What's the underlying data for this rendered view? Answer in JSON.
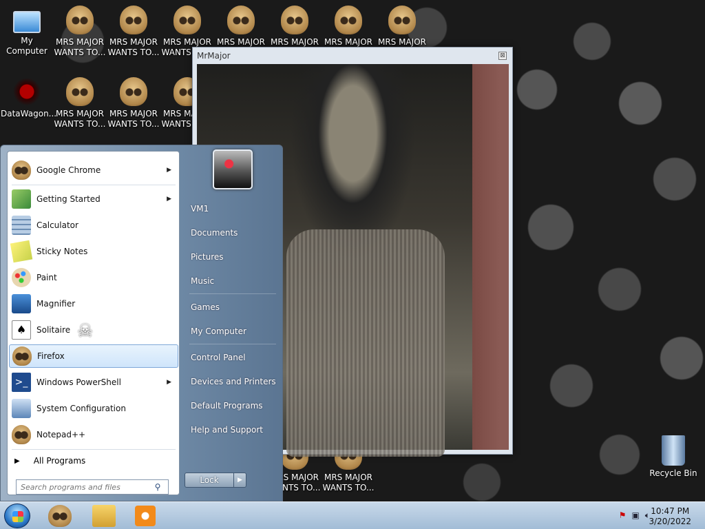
{
  "desktop": {
    "icons": [
      {
        "label": "My Computer"
      },
      {
        "label": "DataWagon..."
      },
      {
        "label": "MRS MAJOR WANTS TO..."
      },
      {
        "label": "Recycle Bin"
      }
    ]
  },
  "window": {
    "title": "MrMajor",
    "close": "⊠"
  },
  "start_menu": {
    "programs": [
      {
        "label": "Google Chrome",
        "arrow": "▶"
      },
      {
        "label": "Getting Started",
        "arrow": "▶"
      },
      {
        "label": "Calculator"
      },
      {
        "label": "Sticky Notes"
      },
      {
        "label": "Paint"
      },
      {
        "label": "Magnifier"
      },
      {
        "label": "Solitaire"
      },
      {
        "label": "Firefox"
      },
      {
        "label": "Windows PowerShell",
        "arrow": "▶"
      },
      {
        "label": "System Configuration"
      },
      {
        "label": "Notepad++"
      }
    ],
    "all_programs": "All Programs",
    "search_placeholder": "Search programs and files",
    "right_items": [
      "VM1",
      "Documents",
      "Pictures",
      "Music",
      "Games",
      "My Computer",
      "Control Panel",
      "Devices and Printers",
      "Default Programs",
      "Help and Support"
    ],
    "lock": "Lock"
  },
  "taskbar": {
    "time": "10:47 PM",
    "date": "3/20/2022"
  },
  "colors": {
    "accent": "#2a78c8",
    "selection": "#cfe5fb"
  }
}
